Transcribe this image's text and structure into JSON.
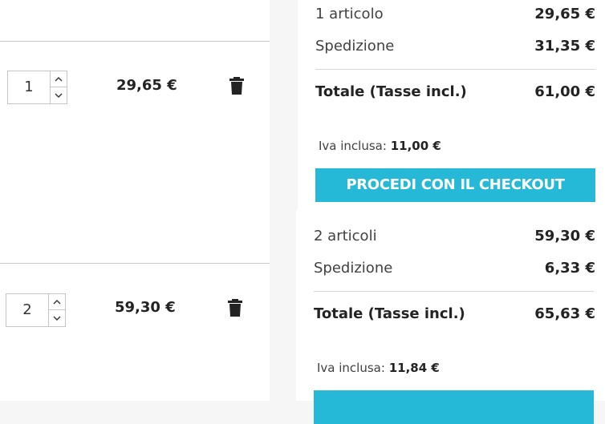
{
  "cart_blocks": [
    {
      "quantity": "1",
      "line_price": "29,65 €",
      "summary": {
        "items_label": "1 articolo",
        "items_value": "29,65 €",
        "shipping_label": "Spedizione",
        "shipping_value": "31,35 €",
        "total_label": "Totale (Tasse incl.)",
        "total_value": "61,00 €",
        "vat_label": "Iva inclusa:",
        "vat_value": "11,00 €"
      },
      "checkout_label": "PROCEDI CON IL CHECKOUT"
    },
    {
      "quantity": "2",
      "line_price": "59,30 €",
      "summary": {
        "items_label": "2 articoli",
        "items_value": "59,30 €",
        "shipping_label": "Spedizione",
        "shipping_value": "6,33 €",
        "total_label": "Totale (Tasse incl.)",
        "total_value": "65,63 €",
        "vat_label": "Iva inclusa:",
        "vat_value": "11,84 €"
      }
    }
  ],
  "icons": {
    "increment": "chevron-up-icon",
    "decrement": "chevron-down-icon",
    "remove": "trash-icon"
  },
  "colors": {
    "checkout_button": "#25b9d7",
    "page_background": "#f6f6f6"
  }
}
